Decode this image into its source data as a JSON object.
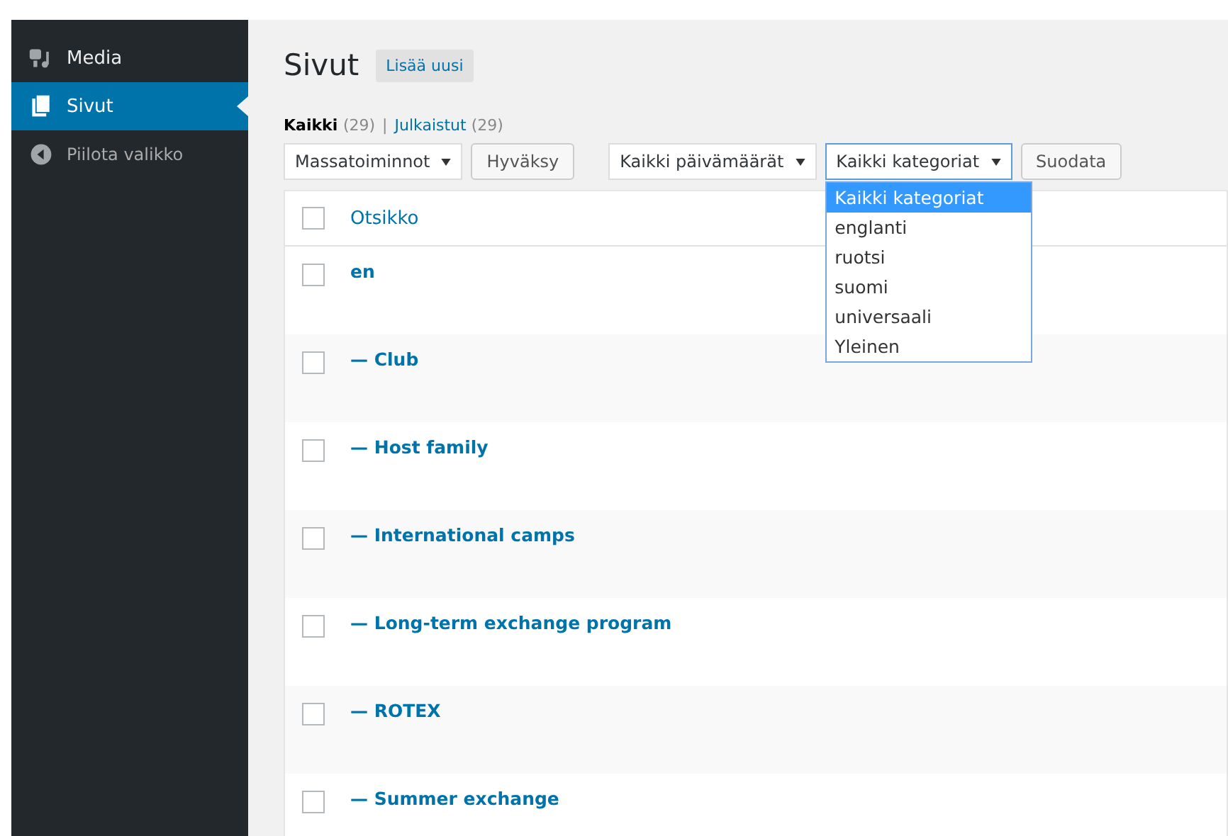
{
  "sidebar": {
    "items": [
      {
        "label": "Media",
        "kind": "media",
        "selected": false
      },
      {
        "label": "Sivut",
        "kind": "pages",
        "selected": true
      },
      {
        "label": "Piilota valikko",
        "kind": "collapse",
        "selected": false
      }
    ]
  },
  "page": {
    "title": "Sivut",
    "add_new": "Lisää uusi"
  },
  "filters_links": [
    {
      "label": "Kaikki",
      "count": "(29)",
      "selected": true
    },
    {
      "label": "Julkaistut",
      "count": "(29)",
      "selected": false
    }
  ],
  "separator": "|",
  "toolbar": {
    "bulk_select": "Massatoiminnot",
    "apply": "Hyväksy",
    "date_select": "Kaikki päivämäärät",
    "category_select": "Kaikki kategoriat",
    "filter": "Suodata"
  },
  "category_dropdown": {
    "expanded": true,
    "options": [
      {
        "label": "Kaikki kategoriat",
        "selected": true
      },
      {
        "label": "englanti",
        "selected": false
      },
      {
        "label": "ruotsi",
        "selected": false
      },
      {
        "label": "suomi",
        "selected": false
      },
      {
        "label": "universaali",
        "selected": false
      },
      {
        "label": "Yleinen",
        "selected": false
      }
    ]
  },
  "table": {
    "select_all_checked": false,
    "columns": [
      "Otsikko"
    ],
    "rows": [
      {
        "title": "en",
        "checked": false
      },
      {
        "title": "— Club",
        "checked": false
      },
      {
        "title": "— Host family",
        "checked": false
      },
      {
        "title": "— International camps",
        "checked": false
      },
      {
        "title": "— Long-term exchange program",
        "checked": false
      },
      {
        "title": "— ROTEX",
        "checked": false
      },
      {
        "title": "— Summer exchange",
        "checked": false
      }
    ]
  }
}
